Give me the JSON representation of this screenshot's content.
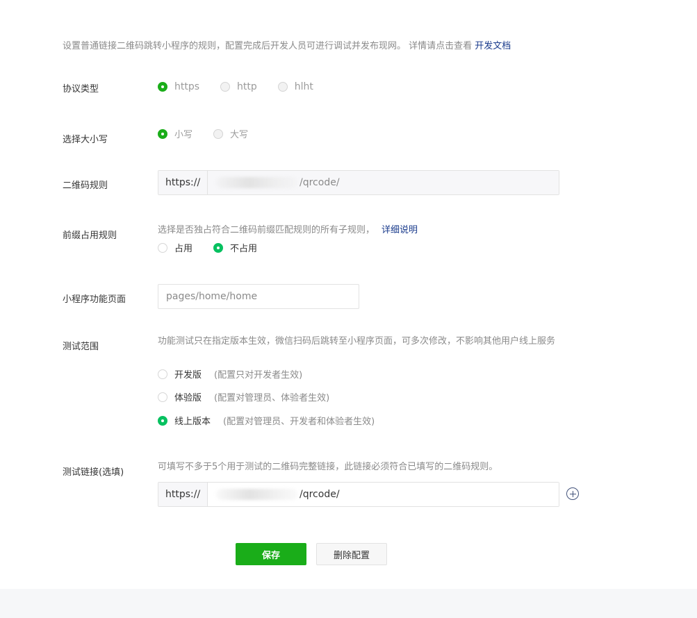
{
  "intro": {
    "text": "设置普通链接二维码跳转小程序的规则，配置完成后开发人员可进行调试并发布现网。 详情请点击查看",
    "link": "开发文档"
  },
  "protocol": {
    "label": "协议类型",
    "options": [
      "https",
      "http",
      "hlht"
    ],
    "selected": "https"
  },
  "case": {
    "label": "选择大小写",
    "options": [
      "小写",
      "大写"
    ],
    "selected": "小写"
  },
  "qr_rule": {
    "label": "二维码规则",
    "prefix": "https://",
    "suffix": "/qrcode/"
  },
  "prefix_rule": {
    "label": "前缀占用规则",
    "desc": "选择是否独占符合二维码前缀匹配规则的所有子规则，",
    "link": "详细说明",
    "options": [
      "占用",
      "不占用"
    ],
    "selected": "不占用"
  },
  "page": {
    "label": "小程序功能页面",
    "value": "pages/home/home"
  },
  "test_scope": {
    "label": "测试范围",
    "desc": "功能测试只在指定版本生效，微信扫码后跳转至小程序页面，可多次修改，不影响其他用户线上服务",
    "options": [
      {
        "label": "开发版",
        "hint": "(配置只对开发者生效)"
      },
      {
        "label": "体验版",
        "hint": "(配置对管理员、体验者生效)"
      },
      {
        "label": "线上版本",
        "hint": "(配置对管理员、开发者和体验者生效)"
      }
    ],
    "selected": "线上版本"
  },
  "test_link": {
    "label": "测试链接(选填)",
    "desc": "可填写不多于5个用于测试的二维码完整链接，此链接必须符合已填写的二维码规则。",
    "prefix": "https://",
    "suffix": "/qrcode/"
  },
  "actions": {
    "save": "保存",
    "delete": "删除配置"
  },
  "colors": {
    "primary": "#1aad19",
    "radio_alt": "#07c160",
    "link": "#1a3b8c"
  }
}
